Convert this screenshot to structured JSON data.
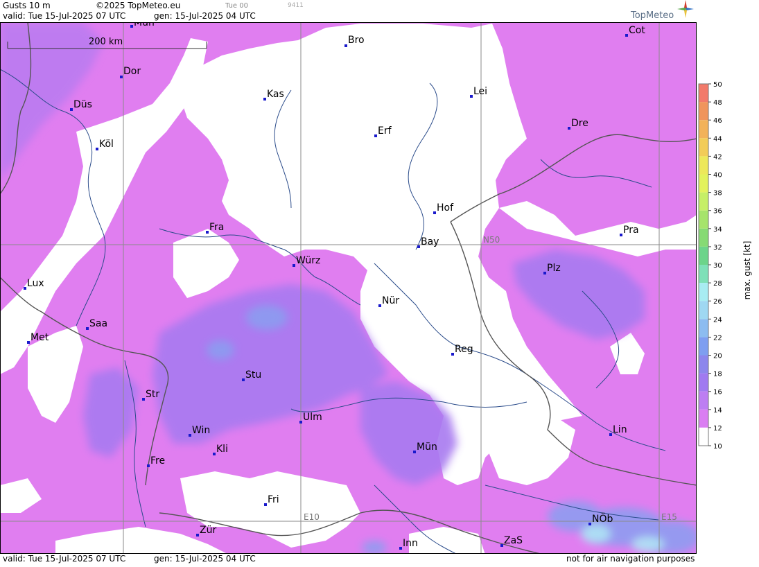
{
  "header": {
    "title": "Gusts 10 m",
    "copyright": "©2025 TopMeteo.eu",
    "valid": "valid:  Tue  15-Jul-2025  07 UTC",
    "generated": "gen: 15-Jul-2025 04 UTC",
    "run": "Tue 00",
    "code": "9411",
    "brand": "TopMeteo"
  },
  "footer": {
    "valid": "valid:  Tue  15-Jul-2025  07 UTC",
    "generated": "gen: 15-Jul-2025 04 UTC",
    "disclaimer": "not for air navigation purposes"
  },
  "map": {
    "scale_label": "200 km",
    "grid_labels": {
      "lat": "N50",
      "lon1": "E10",
      "lon2": "E15"
    },
    "cities": [
      {
        "name": "Mün"
      },
      {
        "name": "Bro"
      },
      {
        "name": "Cot"
      },
      {
        "name": "Dor"
      },
      {
        "name": "Kas"
      },
      {
        "name": "Lei"
      },
      {
        "name": "Düs"
      },
      {
        "name": "Erf"
      },
      {
        "name": "Dre"
      },
      {
        "name": "Köl"
      },
      {
        "name": "Hof"
      },
      {
        "name": "Fra"
      },
      {
        "name": "Pra"
      },
      {
        "name": "Bay"
      },
      {
        "name": "Würz"
      },
      {
        "name": "Plz"
      },
      {
        "name": "Lux"
      },
      {
        "name": "Nür"
      },
      {
        "name": "Saa"
      },
      {
        "name": "Met"
      },
      {
        "name": "Reg"
      },
      {
        "name": "Stu"
      },
      {
        "name": "Str"
      },
      {
        "name": "Ulm"
      },
      {
        "name": "Win"
      },
      {
        "name": "Lin"
      },
      {
        "name": "Kli"
      },
      {
        "name": "Mün"
      },
      {
        "name": "Fre"
      },
      {
        "name": "Fri"
      },
      {
        "name": "NÖb"
      },
      {
        "name": "Zür"
      },
      {
        "name": "ZaS"
      },
      {
        "name": "Inn"
      }
    ]
  },
  "legend": {
    "title": "max. gust  [kt]",
    "ticks": [
      "50",
      "48",
      "46",
      "44",
      "42",
      "40",
      "38",
      "36",
      "34",
      "32",
      "30",
      "28",
      "26",
      "24",
      "22",
      "20",
      "18",
      "16",
      "14",
      "12",
      "10"
    ],
    "colors": [
      "#f27a6a",
      "#f0955c",
      "#f2b25a",
      "#f2cc58",
      "#ede85a",
      "#e3f25c",
      "#c6ef66",
      "#a6e46c",
      "#86da74",
      "#6cd48a",
      "#7ee0b8",
      "#a8ecf2",
      "#9fd8f2",
      "#8cbcf0",
      "#7e9ef0",
      "#8c86ec",
      "#a07af0",
      "#bd7ef2",
      "#da7ef2",
      "#ffffff"
    ],
    "accent_low": "#e07ef0",
    "accent_mid": "#a77af0"
  }
}
